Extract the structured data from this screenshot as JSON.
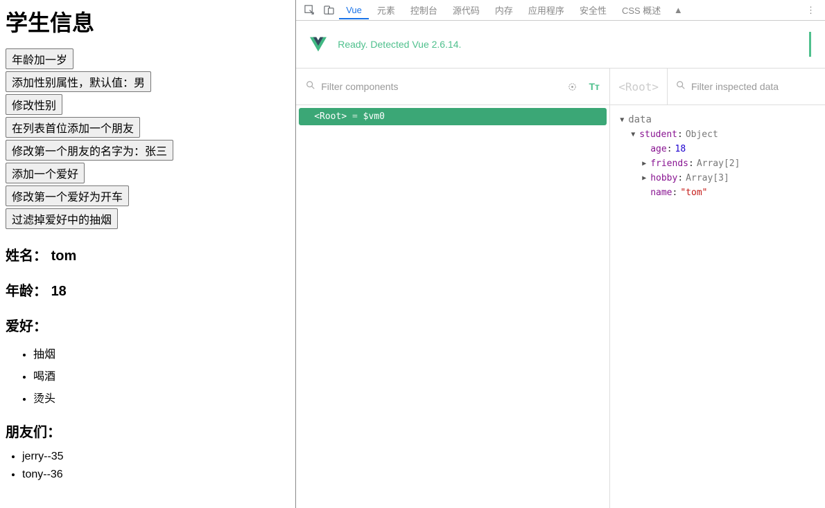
{
  "app": {
    "title": "学生信息",
    "buttons": [
      "年龄加一岁",
      "添加性别属性，默认值：男",
      "修改性别",
      "在列表首位添加一个朋友",
      "修改第一个朋友的名字为：张三",
      "添加一个爱好",
      "修改第一个爱好为开车",
      "过滤掉爱好中的抽烟"
    ],
    "name_label": "姓名：",
    "name_value": "tom",
    "age_label": "年龄：",
    "age_value": "18",
    "hobby_label": "爱好：",
    "hobbies": [
      "抽烟",
      "喝酒",
      "烫头"
    ],
    "friends_label": "朋友们：",
    "friends": [
      "jerry--35",
      "tony--36"
    ]
  },
  "devtools": {
    "tabs": [
      "Vue",
      "元素",
      "控制台",
      "源代码",
      "内存",
      "应用程序",
      "安全性",
      "CSS 概述"
    ],
    "status": "Ready. Detected Vue 2.6.14.",
    "filter_components_placeholder": "Filter components",
    "root_label": "<Root>",
    "filter_inspected_placeholder": "Filter inspected data",
    "tree_selected": "<Root>",
    "tree_eq": " = ",
    "tree_var": "$vm0",
    "data": {
      "title": "data",
      "rows": [
        {
          "indent": 1,
          "arrow": "down",
          "key": "student",
          "valtype": "obj",
          "val": "Object"
        },
        {
          "indent": 2,
          "arrow": "none",
          "key": "age",
          "valtype": "num",
          "val": "18"
        },
        {
          "indent": 2,
          "arrow": "right",
          "key": "friends",
          "valtype": "obj",
          "val": "Array[2]"
        },
        {
          "indent": 2,
          "arrow": "right",
          "key": "hobby",
          "valtype": "obj",
          "val": "Array[3]"
        },
        {
          "indent": 2,
          "arrow": "none",
          "key": "name",
          "valtype": "str",
          "val": "\"tom\""
        }
      ]
    }
  }
}
